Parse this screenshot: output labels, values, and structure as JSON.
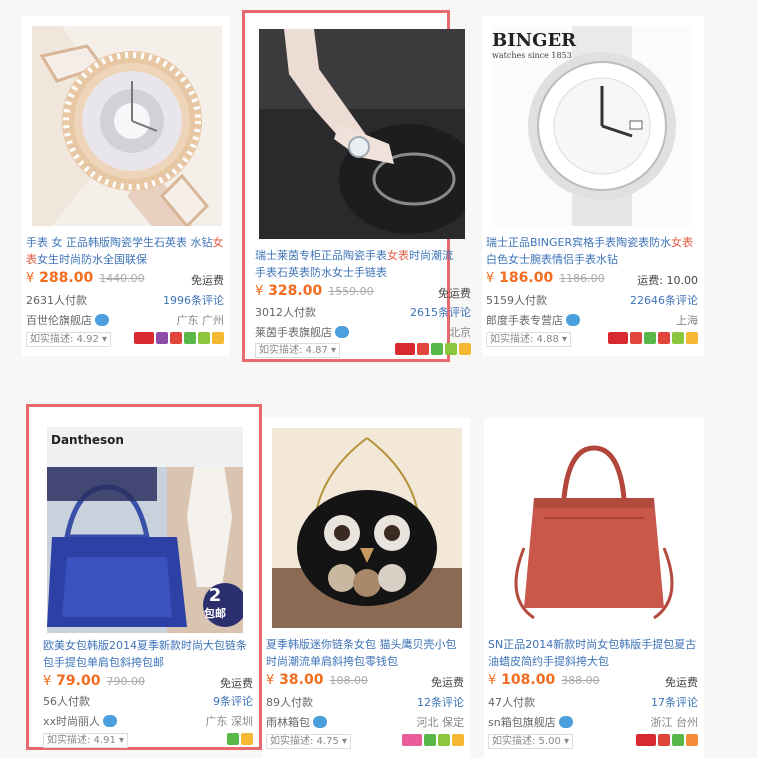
{
  "products": [
    {
      "title_pre": "手表 女 正品韩版陶瓷学生石英表 水钻",
      "title_kw": "女表",
      "title_post": "女生时尚防水全国联保",
      "price": "288.00",
      "orig": "1440.00",
      "ship": "免运费",
      "paid": "2631人付款",
      "reviews": "1996条评论",
      "shop": "百世伦旗舰店",
      "loc": "广东 广州",
      "desc": "如实描述: 4.92",
      "image": "rose-gold-crystal-watch"
    },
    {
      "title_pre": "瑞士莱茵专柜正品陶瓷手表",
      "title_kw": "女表",
      "title_post": "时尚潮流手表石英表防水女士手链表",
      "price": "328.00",
      "orig": "1559.00",
      "ship": "免运费",
      "paid": "3012人付款",
      "reviews": "2615条评论",
      "shop": "莱茵手表旗舰店",
      "loc": "北京",
      "desc": "如实描述: 4.87",
      "image": "wrist-bracelet-watch"
    },
    {
      "title_pre": "瑞士正品BINGER宾格手表陶瓷表防水",
      "title_kw": "女表",
      "title_post": "白色女士腕表情侣手表水钻",
      "price": "186.00",
      "orig": "1186.00",
      "ship": "运费: 10.00",
      "paid": "5159人付款",
      "reviews": "22646条评论",
      "shop": "郎度手表专营店",
      "loc": "上海",
      "desc": "如实描述: 4.88",
      "image": "white-ceramic-watch",
      "brand": "BINGER",
      "brand_sub": "watches since 1853"
    },
    {
      "title_pre": "欧美女包韩版2014夏季新款时尚大包链条包手提包单肩包斜挎包",
      "title_kw": "",
      "title_post": "邮",
      "price": "79.00",
      "orig": "790.00",
      "ship": "免运费",
      "paid": "56人付款",
      "reviews": "9条评论",
      "shop": "xx时尚丽人",
      "loc": "广东 深圳",
      "desc": "如实描述: 4.91",
      "image": "blue-handbag",
      "brand": "Dantheson",
      "promo": "2",
      "promo_sub": "包邮"
    },
    {
      "title_pre": "夏季韩版迷你链条女包 猫头鹰贝壳小包 时尚潮流单肩斜挎包零钱包",
      "title_kw": "",
      "title_post": "",
      "price": "38.00",
      "orig": "108.00",
      "ship": "免运费",
      "paid": "89人付款",
      "reviews": "12条评论",
      "shop": "雨林箱包",
      "loc": "河北 保定",
      "desc": "如实描述: 4.75",
      "image": "owl-chain-bag"
    },
    {
      "title_pre": "SN正品2014新款时尚女包韩版手提包夏古油蜡皮简约手提斜挎大包",
      "title_kw": "",
      "title_post": "",
      "price": "108.00",
      "orig": "388.00",
      "ship": "免运费",
      "paid": "47人付款",
      "reviews": "17条评论",
      "shop": "sn箱包旗舰店",
      "loc": "浙江 台州",
      "desc": "如实描述: 5.00",
      "image": "red-tote-bag"
    }
  ],
  "currency": "¥"
}
